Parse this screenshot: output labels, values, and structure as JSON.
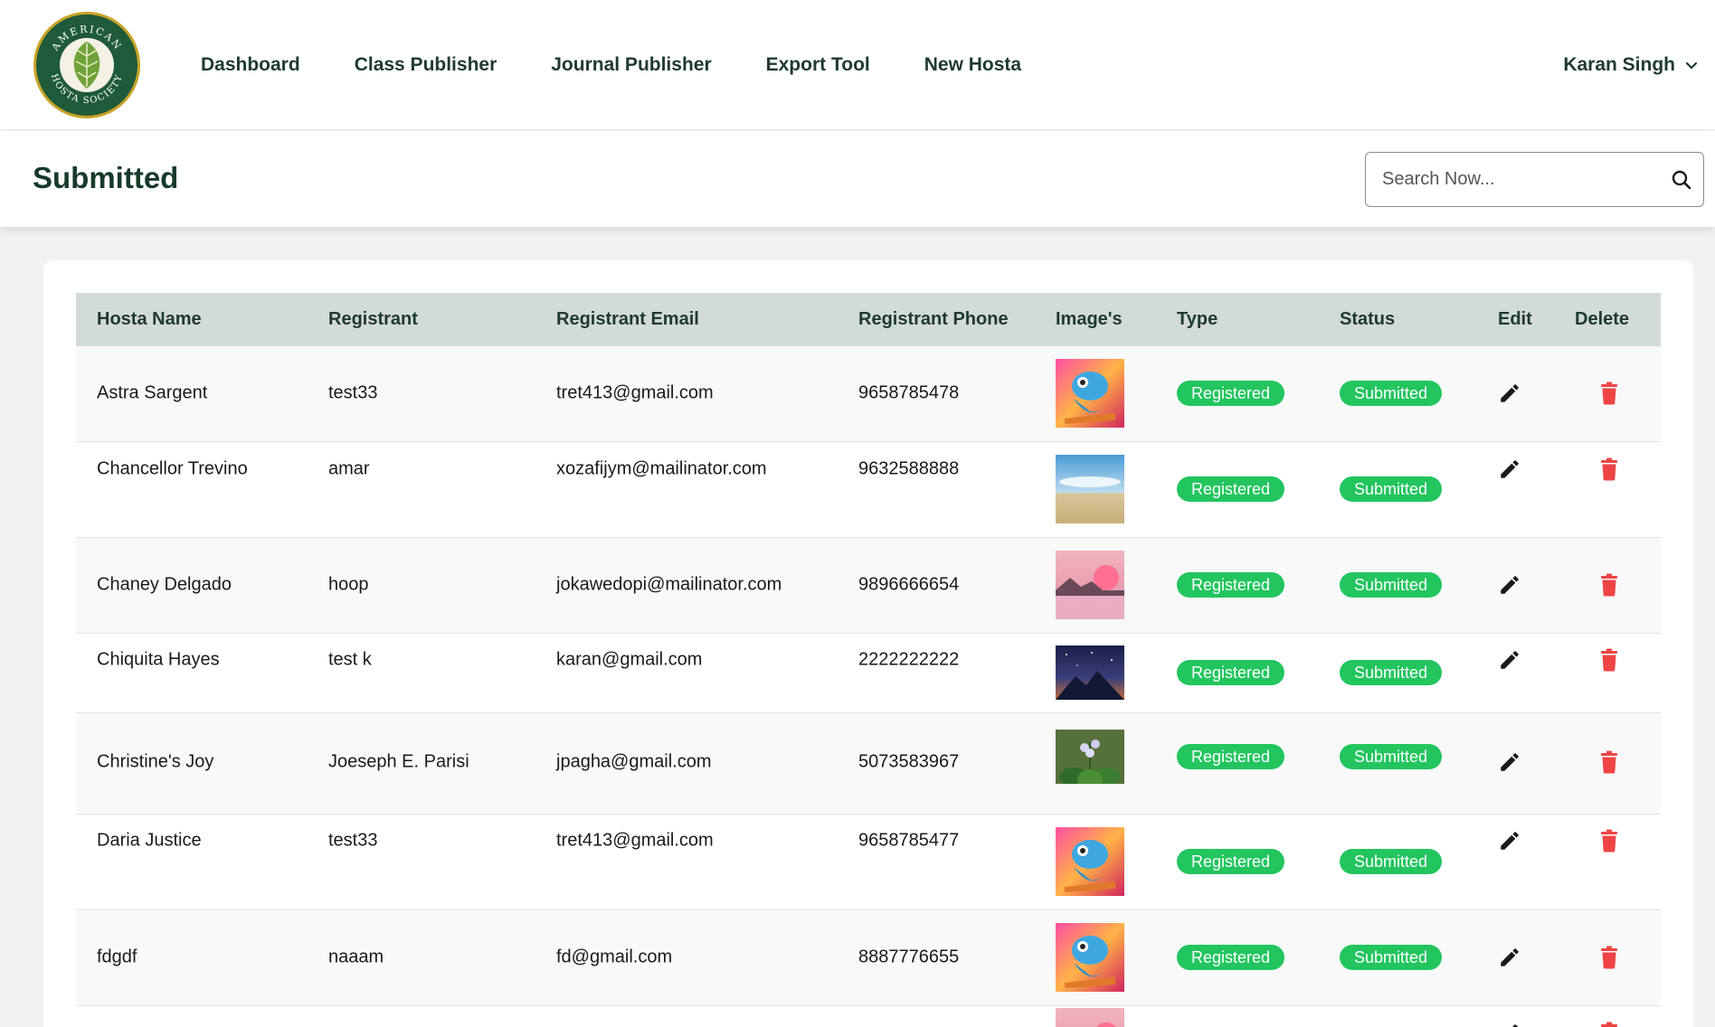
{
  "brand": {
    "logo_text_top": "AMERICAN",
    "logo_text_bottom": "HOSTA SOCIETY"
  },
  "nav": [
    "Dashboard",
    "Class Publisher",
    "Journal Publisher",
    "Export Tool",
    "New Hosta"
  ],
  "user": {
    "name": "Karan Singh"
  },
  "page": {
    "title": "Submitted"
  },
  "search": {
    "placeholder": "Search Now..."
  },
  "table": {
    "columns": [
      "Hosta Name",
      "Registrant",
      "Registrant Email",
      "Registrant Phone",
      "Image's",
      "Type",
      "Status",
      "Edit",
      "Delete"
    ],
    "rows": [
      {
        "name": "Astra Sargent",
        "registrant": "test33",
        "email": "tret413@gmail.com",
        "phone": "9658785478",
        "image": "chameleon",
        "type": "Registered",
        "status": "Submitted"
      },
      {
        "name": "Chancellor Trevino",
        "registrant": "amar",
        "email": "xozafijym@mailinator.com",
        "phone": "9632588888",
        "image": "desert-sky",
        "type": "Registered",
        "status": "Submitted"
      },
      {
        "name": "Chaney Delgado",
        "registrant": "hoop",
        "email": "jokawedopi@mailinator.com",
        "phone": "9896666654",
        "image": "pink-lake",
        "type": "Registered",
        "status": "Submitted"
      },
      {
        "name": "Chiquita Hayes",
        "registrant": "test k",
        "email": "karan@gmail.com",
        "phone": "2222222222",
        "image": "night-mountain",
        "type": "Registered",
        "status": "Submitted"
      },
      {
        "name": "Christine's Joy",
        "registrant": "Joeseph E. Parisi",
        "email": "jpagha@gmail.com",
        "phone": "5073583967",
        "image": "hosta-plant",
        "type": "Registered",
        "status": "Submitted"
      },
      {
        "name": "Daria Justice",
        "registrant": "test33",
        "email": "tret413@gmail.com",
        "phone": "9658785477",
        "image": "chameleon",
        "type": "Registered",
        "status": "Submitted"
      },
      {
        "name": "fdgdf",
        "registrant": "naaam",
        "email": "fd@gmail.com",
        "phone": "8887776655",
        "image": "chameleon",
        "type": "Registered",
        "status": "Submitted"
      }
    ]
  },
  "colors": {
    "brand_green": "#1f3a2e",
    "header_row": "#d2dbd6",
    "pill_green": "#22c55e",
    "delete_red": "#ef4444"
  }
}
